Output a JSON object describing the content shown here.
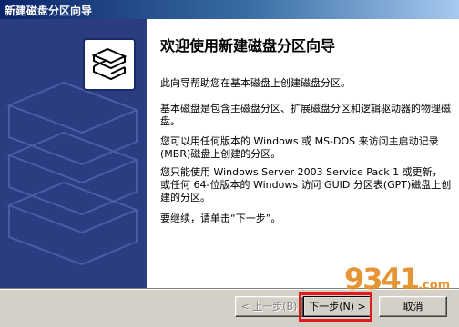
{
  "window": {
    "title": "新建磁盘分区向导"
  },
  "content": {
    "heading": "欢迎使用新建磁盘分区向导",
    "paragraphs": [
      "此向导帮助您在基本磁盘上创建磁盘分区。",
      "基本磁盘是包含主磁盘分区、扩展磁盘分区和逻辑驱动器的物理磁盘。",
      "您可以用任何版本的 Windows 或 MS-DOS 来访问主启动记录(MBR)磁盘上创建的分区。",
      "您只能使用 Windows Server 2003 Service Pack 1 或更新，或任何 64-位版本的 Windows 访问 GUID 分区表(GPT)磁盘上创建的分区。",
      "要继续，请单击“下一步”。"
    ]
  },
  "buttons": {
    "back": "< 上一步(B)",
    "next": "下一步(N) >",
    "cancel": "取消"
  },
  "watermark": {
    "brand": "9341",
    "suffix": ".com"
  }
}
